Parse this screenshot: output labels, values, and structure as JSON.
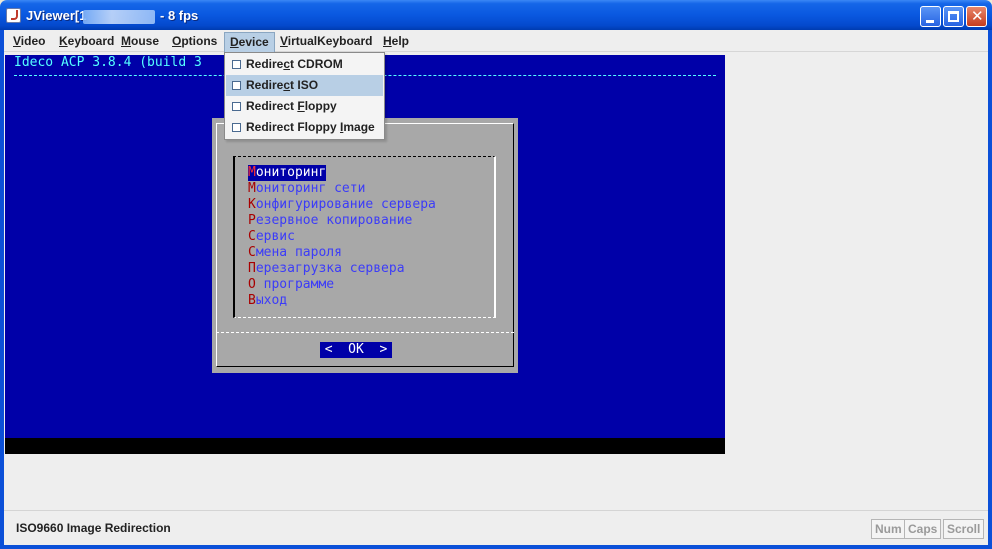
{
  "window": {
    "title_prefix": "JViewer[1",
    "title_suffix": "- 8 fps",
    "minimize_icon": "minimize-icon",
    "maximize_icon": "maximize-icon",
    "close_icon": "close-icon",
    "close_glyph": "✕"
  },
  "menubar": {
    "items": [
      {
        "label_ul": "V",
        "label_rest": "ideo"
      },
      {
        "label_ul": "K",
        "label_rest": "eyboard"
      },
      {
        "label_ul": "M",
        "label_rest": "ouse"
      },
      {
        "label_ul": "O",
        "label_rest": "ptions"
      },
      {
        "label_ul": "D",
        "label_rest": "evice"
      },
      {
        "label_ul": "V",
        "label_rest": "irtualKeyboard"
      },
      {
        "label_ul": "H",
        "label_rest": "elp"
      }
    ],
    "active_menu": "Device"
  },
  "device_menu": {
    "items": [
      {
        "pre": "Redire",
        "ul": "c",
        "post": "t CDROM",
        "checked": false
      },
      {
        "pre": "Redire",
        "ul": "c",
        "post": "t ISO",
        "checked": false
      },
      {
        "pre": "Redirect ",
        "ul": "F",
        "post": "loppy",
        "checked": false
      },
      {
        "pre": "Redirect Floppy ",
        "ul": "I",
        "post": "mage",
        "checked": false
      }
    ],
    "hovered_index": 1
  },
  "console": {
    "header": "Ideco ACP 3.8.4 (build 3",
    "menu": [
      {
        "hot": "М",
        "rest": "ониторинг"
      },
      {
        "hot": "М",
        "rest": "ониторинг сети"
      },
      {
        "hot": "К",
        "rest": "онфигурирование сервера"
      },
      {
        "hot": "Р",
        "rest": "езервное копирование"
      },
      {
        "hot": "С",
        "rest": "ервис"
      },
      {
        "hot": "С",
        "rest": "мена пароля"
      },
      {
        "hot": "П",
        "rest": "ерезагрузка сервера"
      },
      {
        "hot": "О",
        "rest": " программе"
      },
      {
        "hot": "В",
        "rest": "ыход"
      }
    ],
    "selected_index": 0,
    "ok_button": "<  OK  >",
    "colors": {
      "background": "#0000a8",
      "dialog": "#a8a8a8",
      "text_cyan": "#55ffff"
    }
  },
  "statusbar": {
    "text": "ISO9660 Image Redirection",
    "locks": [
      "Num",
      "Caps",
      "Scroll"
    ]
  }
}
